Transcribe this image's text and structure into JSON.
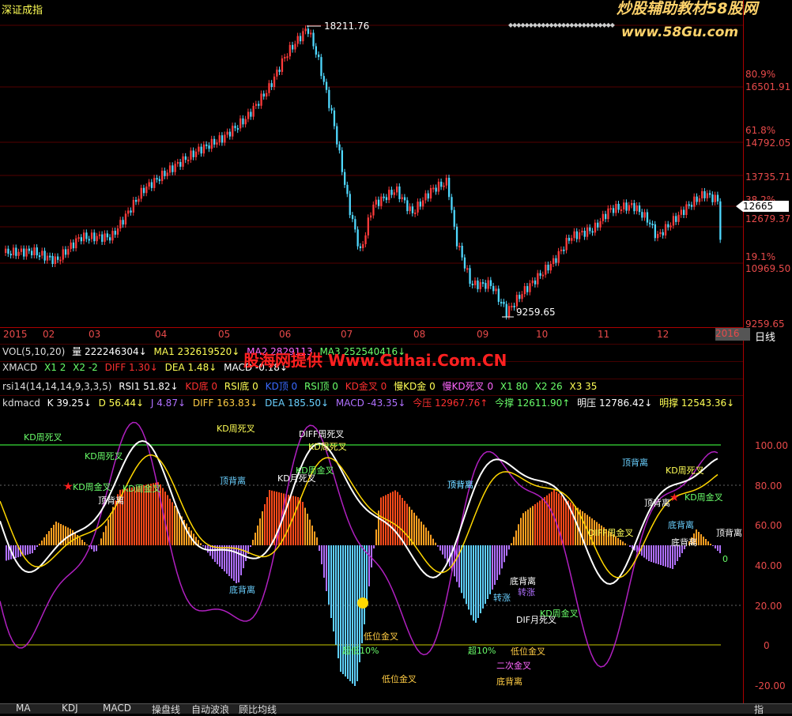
{
  "header": {
    "index_name": "深证成指",
    "brand": "炒股辅助教材58股网",
    "brand_url": "www.58Gu.com",
    "marker_text": "◆◆◆◆◆◆◆◆◆◆◆◆◆◆◆◆◆◆◆◆◆◆◆◆◆◆"
  },
  "price_axis": {
    "labels": [
      "80.9%",
      "16501.91",
      "61.8%",
      "14792.05",
      "13735.71",
      "38.2%",
      "12679.37",
      "19.1%",
      "10969.50",
      "9259.65"
    ],
    "current": "12665"
  },
  "price_annotations": {
    "high": "18211.76",
    "low": "9259.65"
  },
  "date_axis": {
    "labels": [
      "2015",
      "02",
      "03",
      "04",
      "05",
      "06",
      "07",
      "08",
      "09",
      "10",
      "11",
      "12"
    ],
    "selected": "2016",
    "period": "日线"
  },
  "rows": {
    "vol": {
      "name": "VOL(5,10,20)",
      "vol": "量 222246304↓",
      "ma1": "MA1 232619520↓",
      "ma2": "MA2 2829113",
      "ma3": "MA3 252540416↓"
    },
    "xmacd": {
      "name": "XMACD",
      "x1": "X1 2",
      "x2": "X2 -2",
      "diff": "DIFF 1.30↓",
      "dea": "DEA 1.48↓",
      "macd": "MACD -0.18↓"
    },
    "rsi": {
      "name": "rsi14(14,14,14,9,3,3,5)",
      "rsi1": "RSI1 51.82↓",
      "kd_bottom": "KD底 0",
      "rsi_bottom": "RSI底 0",
      "kd_top": "KD顶 0",
      "rsi_top": "RSI顶 0",
      "kd_gold": "KD金叉 0",
      "slow_kd_gold": "慢KD金 0",
      "slow_kd_dead": "慢KD死叉 0",
      "x1": "X1 80",
      "x2": "X2 26",
      "x3": "X3 35"
    },
    "kdmacd": {
      "name": "kdmacd",
      "k": "K 39.25↓",
      "d": "D 56.44↓",
      "j": "J 4.87↓",
      "diff": "DIFF 163.83↓",
      "dea": "DEA 185.50↓",
      "macd": "MACD -43.35↓",
      "today_press": "今压 12967.76↑",
      "today_support": "今撑 12611.90↑",
      "bright_press": "明压 12786.42↓",
      "bright_support": "明撑 12543.36↓"
    }
  },
  "watermark": "股海网提供 Www.Guhai.Com.CN",
  "indicator_axis": {
    "labels": [
      "100.00",
      "80.00",
      "60.00",
      "40.00",
      "20.00",
      "0",
      "-20.00"
    ]
  },
  "indicator_labels": [
    {
      "text": "KD周死叉",
      "color": "#6aff6a"
    },
    {
      "text": "KD周死叉",
      "color": "#6aff6a"
    },
    {
      "text": "KD周金叉",
      "color": "#6aff6a"
    },
    {
      "text": "KD周金叉",
      "color": "#6aff6a"
    },
    {
      "text": "顶背离",
      "color": "#fff"
    },
    {
      "text": "KD周死叉",
      "color": "#ffff55"
    },
    {
      "text": "顶背离",
      "color": "#6ad0ff"
    },
    {
      "text": "DIFF周死叉",
      "color": "#fff"
    },
    {
      "text": "KD周死叉",
      "color": "#ffff55"
    },
    {
      "text": "KD月死叉",
      "color": "#fff"
    },
    {
      "text": "KD周金叉",
      "color": "#6aff6a"
    },
    {
      "text": "顶背离",
      "color": "#6ad0ff"
    },
    {
      "text": "底背离",
      "color": "#6ad0ff"
    },
    {
      "text": "低位金叉",
      "color": "#ffcc44"
    },
    {
      "text": "超低10%",
      "color": "#6aff6a"
    },
    {
      "text": "低位金叉",
      "color": "#ffcc44"
    },
    {
      "text": "顶背离",
      "color": "#6ad0ff"
    },
    {
      "text": "底背离",
      "color": "#fff"
    },
    {
      "text": "转涨",
      "color": "#b070ff"
    },
    {
      "text": "转涨",
      "color": "#6ad0ff"
    },
    {
      "text": "DIF月死叉",
      "color": "#fff"
    },
    {
      "text": "KD周金叉",
      "color": "#6aff6a"
    },
    {
      "text": "超10%",
      "color": "#6aff6a"
    },
    {
      "text": "低位金叉",
      "color": "#ffcc44"
    },
    {
      "text": "二次金叉",
      "color": "#ff66ff"
    },
    {
      "text": "底背离",
      "color": "#ffcc44"
    },
    {
      "text": "DIFF周金叉",
      "color": "#ffff55"
    },
    {
      "text": "顶背离",
      "color": "#6ad0ff"
    },
    {
      "text": "顶背离",
      "color": "#fff"
    },
    {
      "text": "KD周死叉",
      "color": "#ffff55"
    },
    {
      "text": "KD周金叉",
      "color": "#6aff6a"
    },
    {
      "text": "底背离",
      "color": "#6ad0ff"
    },
    {
      "text": "底背离",
      "color": "#fff"
    },
    {
      "text": "顶背离",
      "color": "#fff"
    },
    {
      "text": "0",
      "color": "#6aff6a"
    }
  ],
  "bottom_tabs": [
    "MA",
    "KDJ",
    "MACD",
    "操盘线",
    "自动波浪",
    "顾比均线"
  ],
  "bottom_right": "指"
}
